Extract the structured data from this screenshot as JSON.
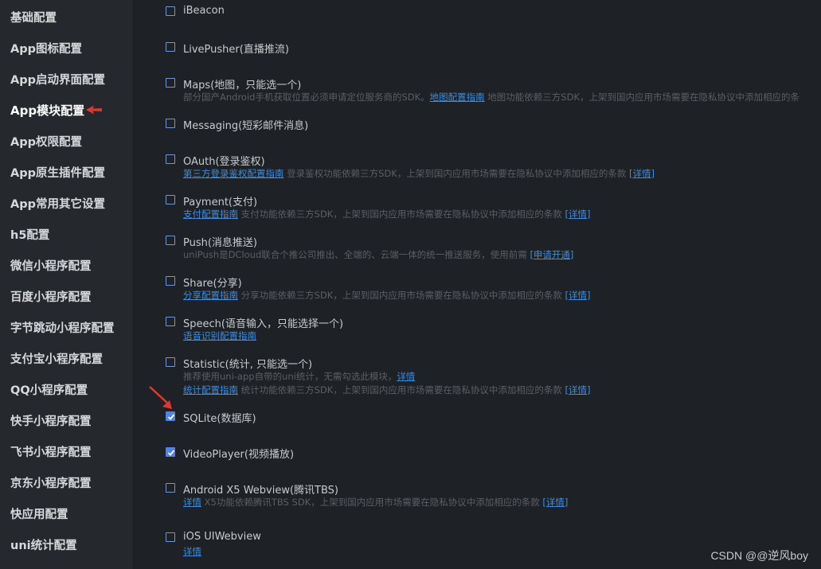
{
  "sidebar": {
    "items": [
      {
        "label": "基础配置"
      },
      {
        "label": "App图标配置"
      },
      {
        "label": "App启动界面配置"
      },
      {
        "label": "App模块配置"
      },
      {
        "label": "App权限配置"
      },
      {
        "label": "App原生插件配置"
      },
      {
        "label": "App常用其它设置"
      },
      {
        "label": "h5配置"
      },
      {
        "label": "微信小程序配置"
      },
      {
        "label": "百度小程序配置"
      },
      {
        "label": "字节跳动小程序配置"
      },
      {
        "label": "支付宝小程序配置"
      },
      {
        "label": "QQ小程序配置"
      },
      {
        "label": "快手小程序配置"
      },
      {
        "label": "飞书小程序配置"
      },
      {
        "label": "京东小程序配置"
      },
      {
        "label": "快应用配置"
      },
      {
        "label": "uni统计配置"
      }
    ],
    "active_index": 3
  },
  "modules": [
    {
      "title": "iBeacon",
      "checked": false
    },
    {
      "title": "LivePusher(直播推流)",
      "checked": false
    },
    {
      "title": "Maps(地图，只能选一个)",
      "checked": false,
      "desc1": {
        "pre": "部分国产Android手机获取位置必须申请定位服务商的SDK。",
        "link": "地图配置指南",
        "post": " 地图功能依赖三方SDK，上架到国内应用市场需要在隐私协议中添加相应的条"
      }
    },
    {
      "title": "Messaging(短彩邮件消息)",
      "checked": false
    },
    {
      "title": "OAuth(登录鉴权)",
      "checked": false,
      "desc1": {
        "link": "第三方登录鉴权配置指南",
        "post": " 登录鉴权功能依赖三方SDK，上架到国内应用市场需要在隐私协议中添加相应的条款 ",
        "link2": "[详情]"
      }
    },
    {
      "title": "Payment(支付)",
      "checked": false,
      "desc1": {
        "link": "支付配置指南",
        "post": " 支付功能依赖三方SDK，上架到国内应用市场需要在隐私协议中添加相应的条款 ",
        "link2": "[详情]"
      }
    },
    {
      "title": "Push(消息推送)",
      "checked": false,
      "desc1": {
        "pre": "uniPush是DCloud联合个推公司推出、全端的、云端一体的统一推送服务，使用前需 ",
        "link": "[申请开通]"
      }
    },
    {
      "title": "Share(分享)",
      "checked": false,
      "desc1": {
        "link": "分享配置指南",
        "post": " 分享功能依赖三方SDK，上架到国内应用市场需要在隐私协议中添加相应的条款 ",
        "link2": "[详情]"
      }
    },
    {
      "title": "Speech(语音输入，只能选择一个)",
      "checked": false,
      "desc1": {
        "link": "语音识别配置指南"
      }
    },
    {
      "title": "Statistic(统计, 只能选一个)",
      "checked": false,
      "desc1": {
        "pre": "推荐使用uni-app自带的uni统计，无需勾选此模块，",
        "link": "详情"
      },
      "desc2": {
        "link": "统计配置指南",
        "post": " 统计功能依赖三方SDK，上架到国内应用市场需要在隐私协议中添加相应的条款 ",
        "link2": "[详情]"
      }
    },
    {
      "title": "SQLite(数据库)",
      "checked": true
    },
    {
      "title": "VideoPlayer(视频播放)",
      "checked": true
    },
    {
      "title": "Android X5 Webview(腾讯TBS)",
      "checked": false,
      "desc1": {
        "link": "详情",
        "post": " X5功能依赖腾讯TBS SDK，上架到国内应用市场需要在隐私协议中添加相应的条款 ",
        "link2": "[详情]"
      }
    },
    {
      "title": "iOS UIWebview",
      "checked": false,
      "desc1": {
        "link": "详情"
      }
    }
  ],
  "watermark": "CSDN @@逆风boy",
  "colors": {
    "accent": "#4d84e6",
    "link": "#3c8de0",
    "arrow": "#e8352b"
  }
}
